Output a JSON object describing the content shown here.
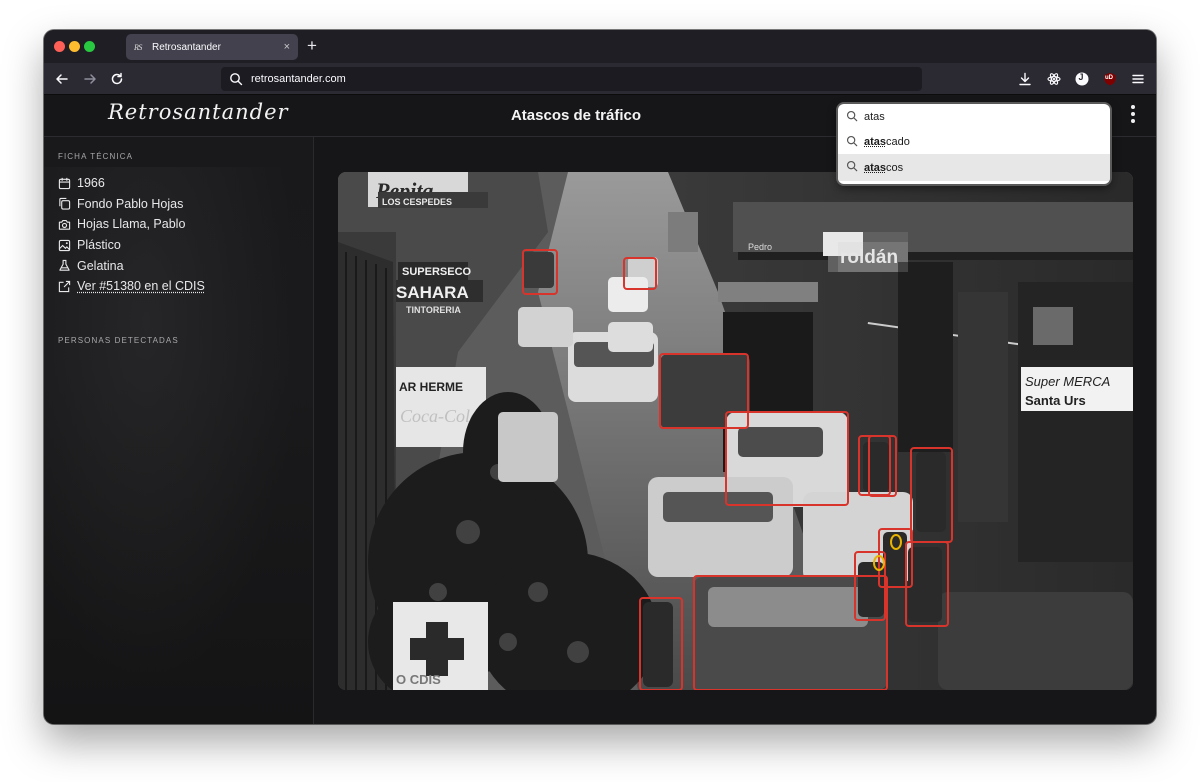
{
  "browser": {
    "tab_title": "Retrosantander",
    "tab_favicon": "RS",
    "new_tab_label": "+",
    "tab_close_label": "×",
    "url": "retrosantander.com",
    "icons": [
      "back-arrow-icon",
      "forward-arrow-icon",
      "reload-icon",
      "search-icon",
      "download-icon",
      "extension-icon",
      "profile-icon",
      "ublock-icon",
      "menu-icon"
    ],
    "profile_initial": "J",
    "ublock_label": "uD"
  },
  "site": {
    "logo": "Retrosantander",
    "title": "Atascos de tráfico"
  },
  "search": {
    "query": "atas",
    "suggestions": [
      {
        "match": "atas",
        "rest": "cado"
      },
      {
        "match": "atas",
        "rest": "cos"
      }
    ],
    "highlighted_index": 1
  },
  "sidebar": {
    "section_ficha": "FICHA TÉCNICA",
    "facts": [
      {
        "icon": "calendar-icon",
        "label": "1966"
      },
      {
        "icon": "copy-icon",
        "label": "Fondo Pablo Hojas"
      },
      {
        "icon": "camera-icon",
        "label": "Hojas Llama, Pablo"
      },
      {
        "icon": "image-icon",
        "label": "Plástico"
      },
      {
        "icon": "flask-icon",
        "label": "Gelatina"
      }
    ],
    "cdis_link": "Ver #51380 en el CDIS",
    "section_personas": "PERSONAS DETECTADAS"
  },
  "photo": {
    "signs": [
      "Pepita",
      "LOS CESPEDES",
      "SUPERSECO",
      "SAHARA",
      "TINTORERIA",
      "roldán",
      "Pedro",
      "AR HERME",
      "Coca-Cola",
      "Super MERCA",
      "Santa Urs",
      "O CDIS"
    ],
    "detection_colors": {
      "red": "#d8342c",
      "yellow": "#e8b400"
    }
  }
}
